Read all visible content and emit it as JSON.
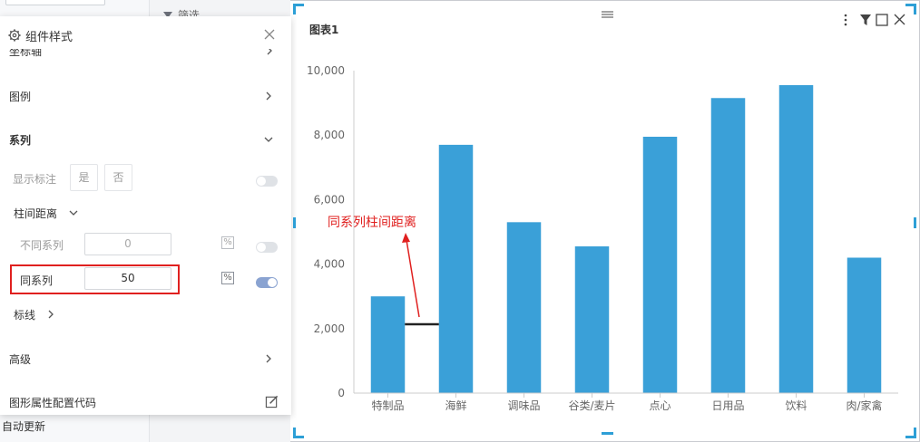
{
  "background": {
    "filter_label": "筛选",
    "auto_update_label": "自动更新"
  },
  "panel": {
    "title": "组件样式",
    "cut_row_label": "坐标轴",
    "legend_label": "图例",
    "series_label": "系列",
    "show_label_text": "显示标注",
    "show_label_yes": "是",
    "show_label_no": "否",
    "bar_gap_label": "柱间距离",
    "diff_series_label": "不同系列",
    "diff_series_value": "0",
    "same_series_label": "同系列",
    "same_series_value": "50",
    "percent_symbol": "%",
    "markline_label": "标线",
    "advanced_label": "高级",
    "code_label": "图形属性配置代码"
  },
  "chart": {
    "title": "图表1",
    "annotation": "同系列柱间距离",
    "accent_color": "#3aa0d8",
    "annotation_color": "#e0201f"
  },
  "chart_data": {
    "type": "bar",
    "categories": [
      "特制品",
      "海鲜",
      "调味品",
      "谷类/麦片",
      "点心",
      "日用品",
      "饮料",
      "肉/家禽"
    ],
    "values": [
      3000,
      7700,
      5300,
      4550,
      7950,
      9150,
      9550,
      4200
    ],
    "yticks": [
      "0",
      "2,000",
      "4,000",
      "6,000",
      "8,000",
      "10,000"
    ],
    "ylim": [
      0,
      10000
    ],
    "grid": false,
    "legend": "none"
  }
}
